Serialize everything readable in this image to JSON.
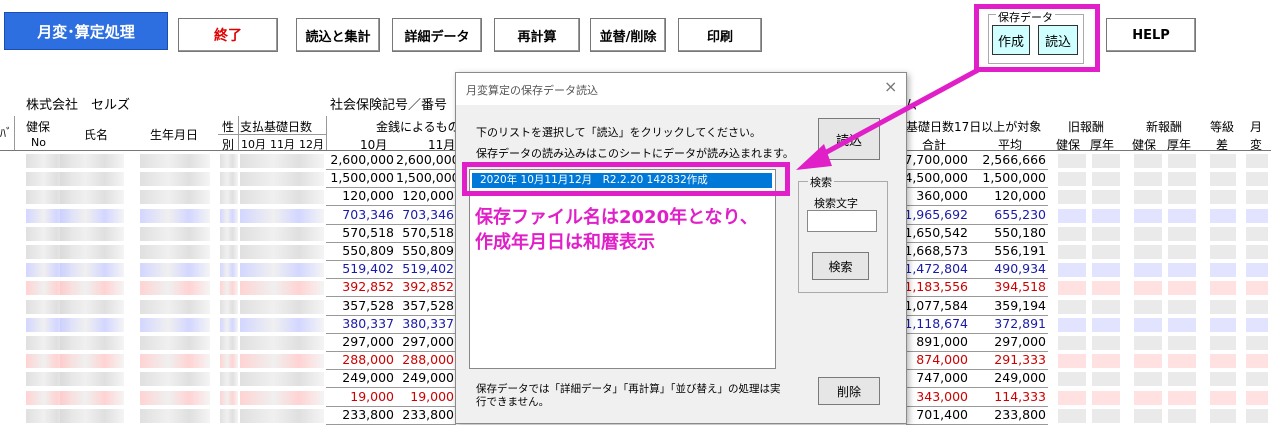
{
  "toolbar": {
    "title": "月変･算定処理",
    "end": "終了",
    "read_sum": "読込と集計",
    "detail": "詳細データ",
    "recalc": "再計算",
    "sort_delete": "並替/削除",
    "print": "印刷",
    "save_group": "保存データ",
    "create": "作成",
    "load": "読込",
    "help": "HELP"
  },
  "sheet": {
    "company": "株式会社　セルズ",
    "insurance_label": "社会保険記号／番号",
    "base_days_label": "基礎日数17日以上が対象",
    "truncated_left": "ﾊﾞ",
    "headers": {
      "health": "健保",
      "no": "No",
      "name": "氏名",
      "birthdate": "生年月日",
      "sex_top": "性",
      "sex_bottom": "別",
      "pay_days": "支払基礎日数",
      "oct": "10月",
      "nov": "11月",
      "dec": "12月",
      "money_label": "金銭によるもの",
      "m10": "10月",
      "m11": "11月",
      "total": "合計",
      "avg": "平均",
      "old_reward": "旧報酬",
      "new_reward": "新報酬",
      "kenpo": "健保",
      "kounen": "厚年",
      "kenpo2": "健保",
      "kounen2": "厚年",
      "grade": "等級",
      "diff": "差",
      "month": "月",
      "change": "変"
    },
    "rows": [
      {
        "m10": "2,600,000",
        "m11": "2,600,000",
        "total": "7,700,000",
        "avg": "2,566,666",
        "color": "#000000"
      },
      {
        "m10": "1,500,000",
        "m11": "1,500,000",
        "total": "4,500,000",
        "avg": "1,500,000",
        "color": "#000000"
      },
      {
        "m10": "120,000",
        "m11": "120,000",
        "total": "360,000",
        "avg": "120,000",
        "color": "#000000"
      },
      {
        "m10": "703,346",
        "m11": "703,346",
        "total": "1,965,692",
        "avg": "655,230",
        "color": "#1a1aa8"
      },
      {
        "m10": "570,518",
        "m11": "570,518",
        "total": "1,650,542",
        "avg": "550,180",
        "color": "#000000"
      },
      {
        "m10": "550,809",
        "m11": "550,809",
        "total": "1,668,573",
        "avg": "556,191",
        "color": "#000000"
      },
      {
        "m10": "519,402",
        "m11": "519,402",
        "total": "1,472,804",
        "avg": "490,934",
        "color": "#1a1aa8"
      },
      {
        "m10": "392,852",
        "m11": "392,852",
        "total": "1,183,556",
        "avg": "394,518",
        "color": "#cc0000"
      },
      {
        "m10": "357,528",
        "m11": "357,528",
        "total": "1,077,584",
        "avg": "359,194",
        "color": "#000000"
      },
      {
        "m10": "380,337",
        "m11": "380,337",
        "total": "1,118,674",
        "avg": "372,891",
        "color": "#1a1aa8"
      },
      {
        "m10": "297,000",
        "m11": "297,000",
        "total": "891,000",
        "avg": "297,000",
        "color": "#000000"
      },
      {
        "m10": "288,000",
        "m11": "288,000",
        "total": "874,000",
        "avg": "291,333",
        "color": "#cc0000"
      },
      {
        "m10": "249,000",
        "m11": "249,000",
        "total": "747,000",
        "avg": "249,000",
        "color": "#000000"
      },
      {
        "m10": "19,000",
        "m11": "19,000",
        "total": "343,000",
        "avg": "114,333",
        "color": "#cc0000"
      },
      {
        "m10": "233,800",
        "m11": "233,800",
        "total": "701,400",
        "avg": "233,800",
        "color": "#000000"
      }
    ]
  },
  "dialog": {
    "title": "月変算定の保存データ読込",
    "instruction1": "下のリストを選択して「読込」をクリックしてください。",
    "instruction2": "保存データの読み込みはこのシートにデータが読み込まれます。",
    "list_item": "2020年 10月11月12月　R2.2.20 142832作成",
    "load_button": "読込",
    "search_group": "検索",
    "search_label": "検索文字",
    "search_button": "検索",
    "note": "保存データでは「詳細データ」「再計算」「並び替え」の処理は実行できません。",
    "delete_button": "削除"
  },
  "annotation": {
    "line1": "保存ファイル名は2020年となり、",
    "line2": "作成年月日は和暦表示",
    "color": "#e01fc8"
  }
}
